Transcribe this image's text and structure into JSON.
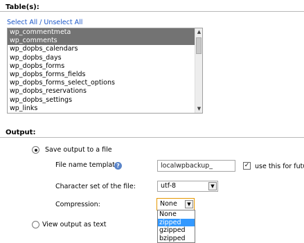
{
  "tables_section": {
    "title": "Table(s):",
    "select_all": "Select All",
    "separator": " / ",
    "unselect_all": "Unselect All",
    "items": [
      {
        "label": "wp_commentmeta",
        "selected": true
      },
      {
        "label": "wp_comments",
        "selected": true
      },
      {
        "label": "wp_dopbs_calendars",
        "selected": false
      },
      {
        "label": "wp_dopbs_days",
        "selected": false
      },
      {
        "label": "wp_dopbs_forms",
        "selected": false
      },
      {
        "label": "wp_dopbs_forms_fields",
        "selected": false
      },
      {
        "label": "wp_dopbs_forms_select_options",
        "selected": false
      },
      {
        "label": "wp_dopbs_reservations",
        "selected": false
      },
      {
        "label": "wp_dopbs_settings",
        "selected": false
      },
      {
        "label": "wp_links",
        "selected": false
      }
    ]
  },
  "output_section": {
    "title": "Output:",
    "save_option_label": "Save output to a file",
    "file_name_label": "File name template:",
    "file_name_value": "localwpbackup_",
    "use_future_label": "use this for future",
    "use_future_checked": true,
    "charset_label": "Character set of the file:",
    "charset_value": "utf-8",
    "compression_label": "Compression:",
    "compression_value": "None",
    "compression_options": [
      "None",
      "zipped",
      "gzipped",
      "bzipped"
    ],
    "compression_highlighted": "zipped",
    "view_option_label": "View output as text"
  },
  "icons": {
    "help": "help-icon",
    "dropdown": "chevron-down-icon"
  },
  "colors": {
    "selected_row": "#737373",
    "link": "#1a56c8",
    "highlight": "#3399ff",
    "focus_border": "#e59700"
  }
}
